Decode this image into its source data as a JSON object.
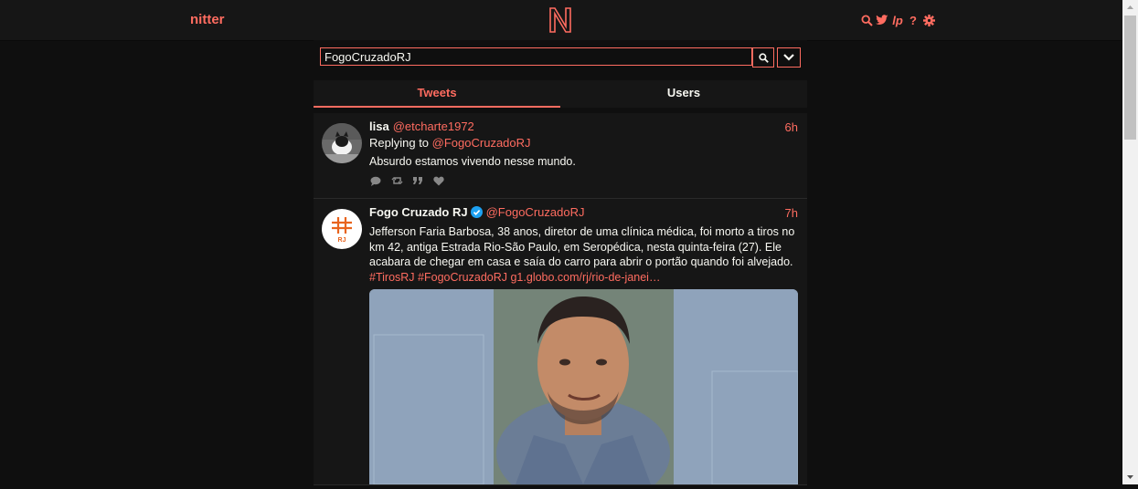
{
  "nav": {
    "brand": "nitter",
    "logo_letter": "N",
    "icons": [
      "search-icon",
      "twitter-icon",
      "liberapay-icon",
      "help-icon",
      "settings-icon"
    ],
    "liberapay_label": "lp",
    "help_label": "?"
  },
  "search": {
    "value": "FogoCruzadoRJ"
  },
  "tabs": [
    {
      "label": "Tweets",
      "active": true
    },
    {
      "label": "Users",
      "active": false
    }
  ],
  "tweets": [
    {
      "fullname": "lisa",
      "username": "@etcharte1972",
      "date": "6h",
      "replying_prefix": "Replying to",
      "replying_to": "@FogoCruzadoRJ",
      "text": "Absurdo estamos vivendo nesse mundo.",
      "stats_icons": [
        "comment-icon",
        "retweet-icon",
        "quote-icon",
        "heart-icon"
      ]
    },
    {
      "fullname": "Fogo Cruzado RJ",
      "verified": true,
      "username": "@FogoCruzadoRJ",
      "date": "7h",
      "text": "Jefferson Faria Barbosa, 38 anos, diretor de uma clínica médica, foi morto a tiros no km 42, antiga Estrada Rio-São Paulo, em Seropédica, nesta quinta-feira (27). Ele acabara de chegar em casa e saía do carro para abrir o portão quando foi alvejado.",
      "hashtag1": "#TirosRJ",
      "hashtag2": "#FogoCruzadoRJ",
      "link": "g1.globo.com/rj/rio-de-janei…",
      "avatar_label": "RJ"
    }
  ],
  "colors": {
    "accent": "#ff6c60",
    "background": "#0f0f0f",
    "panel": "#161616",
    "text": "#f8f8f2"
  }
}
